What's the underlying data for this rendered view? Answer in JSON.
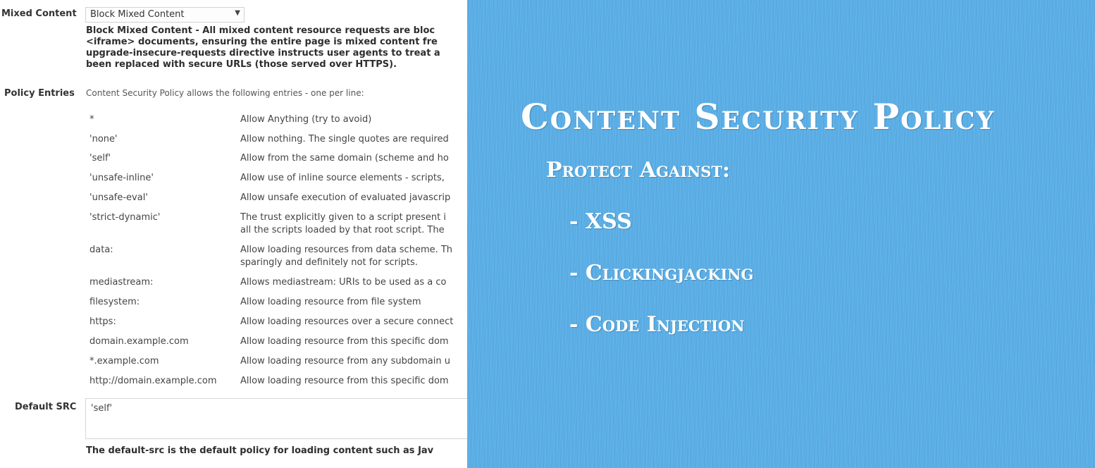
{
  "settings": {
    "mixed_content": {
      "label": "Mixed Content",
      "selected": "Block Mixed Content",
      "description_lines": [
        "Block Mixed Content - All mixed content resource requests are bloc",
        "<iframe> documents, ensuring the entire page is mixed content fre",
        "upgrade-insecure-requests directive instructs user agents to treat a",
        "been replaced with secure URLs (those served over HTTPS)."
      ]
    },
    "policy_entries": {
      "label": "Policy Entries",
      "intro": "Content Security Policy allows the following entries - one per line:",
      "rows": [
        {
          "value": "*",
          "description": "Allow Anything (try to avoid)"
        },
        {
          "value": "'none'",
          "description": "Allow nothing. The single quotes are required"
        },
        {
          "value": "'self'",
          "description": "Allow from the same domain (scheme and ho"
        },
        {
          "value": "'unsafe-inline'",
          "description": "Allow use of inline source elements - scripts,"
        },
        {
          "value": "'unsafe-eval'",
          "description": "Allow unsafe execution of evaluated javascrip"
        },
        {
          "value": "'strict-dynamic'",
          "description": "The trust explicitly given to a script present i",
          "description2": "all the scripts loaded by that root script. The"
        },
        {
          "value": "data:",
          "description": "Allow loading resources from data scheme. Th",
          "description2": "sparingly and definitely not for scripts."
        },
        {
          "value": "mediastream:",
          "description": "Allows mediastream: URIs to be used as a co"
        },
        {
          "value": "filesystem:",
          "description": "Allow loading resource from file system"
        },
        {
          "value": "https:",
          "description": "Allow loading resources over a secure connect"
        },
        {
          "value": "domain.example.com",
          "description": "Allow loading resource from this specific dom"
        },
        {
          "value": "*.example.com",
          "description": "Allow loading resource from any subdomain u"
        },
        {
          "value": "http://domain.example.com",
          "description": "Allow loading resource from this specific dom"
        }
      ]
    },
    "default_src": {
      "label": "Default SRC",
      "value": "'self'",
      "description": "The default-src is the default policy for loading content such as Jav"
    }
  },
  "banner": {
    "title": "Content Security Policy",
    "subtitle": "Protect Against:",
    "items": [
      "- XSS",
      "- Clickingjacking",
      "- Code Injection"
    ],
    "background_color": "#5aaee5",
    "text_color": "#ffffff"
  }
}
